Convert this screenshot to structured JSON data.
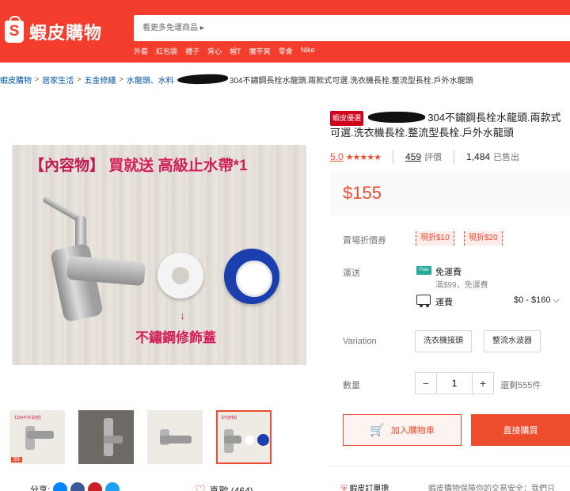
{
  "header": {
    "logo_text": "蝦皮購物",
    "logo_letter": "S",
    "search_placeholder": "看更多免運商品 ▸",
    "hot_keywords": [
      "外套",
      "紅包袋",
      "襪子",
      "背心",
      "帽T",
      "魔芋爽",
      "零食",
      "Nike"
    ]
  },
  "breadcrumb": {
    "items": [
      "蝦皮購物",
      "居家生活",
      "五金修繕",
      "水龍頭、水料"
    ],
    "tail": "304不鏽鋼長栓水龍頭.兩款式可選.洗衣機長栓.整流型長栓.戶外水龍頭"
  },
  "gallery": {
    "banner_part1": "【內容物】",
    "banner_part2": "買就送 高級止水帶*1",
    "arrow": "↓",
    "deco_label": "不鏽鋼修飾蓋",
    "thumbs": [
      {
        "caption": "【304戶外長栓】",
        "sale": "99"
      },
      {
        "caption": "",
        "sale": ""
      },
      {
        "caption": "",
        "sale": ""
      },
      {
        "caption": "【內容物】",
        "sale": ""
      }
    ]
  },
  "social": {
    "share_label": "分享:",
    "like_label": "喜歡 (464)"
  },
  "product": {
    "badge": "蝦皮優選",
    "title_tail": "304不鏽鋼長栓水龍頭.兩款式可選.洗衣機長栓.整流型長栓.戶外水龍頭",
    "title_line2": "栓.戶外水龍頭",
    "rating": "5.0",
    "stars": "★★★★★",
    "review_count": "459",
    "review_label": "評價",
    "sold_count": "1,484",
    "sold_label": "已售出",
    "price": "$155"
  },
  "vouchers": {
    "label": "賣場折價券",
    "items": [
      "現折$10",
      "現折$20"
    ]
  },
  "shipping": {
    "label": "運送",
    "free_tag": "Free",
    "free_title": "免運費",
    "free_condition": "滿$99，免運費",
    "fee_label": "運費",
    "fee_range": "$0 - $160",
    "chevron": "⌵"
  },
  "variation": {
    "label": "Variation",
    "options": [
      "洗衣機接頭",
      "整流水波器"
    ]
  },
  "quantity": {
    "label": "數量",
    "minus": "−",
    "plus": "+",
    "value": "1",
    "stock": "還剩555件"
  },
  "actions": {
    "add_to_cart": "加入購物車",
    "buy_now": "直接購買"
  },
  "guarantee": {
    "label": "蝦皮訂單擔",
    "text": "蝦皮購物保障你的交易安全：我們只"
  },
  "colors": {
    "brand": "#f53d2d",
    "accent": "#ee4d2d",
    "free_shipping": "#26aa99"
  }
}
